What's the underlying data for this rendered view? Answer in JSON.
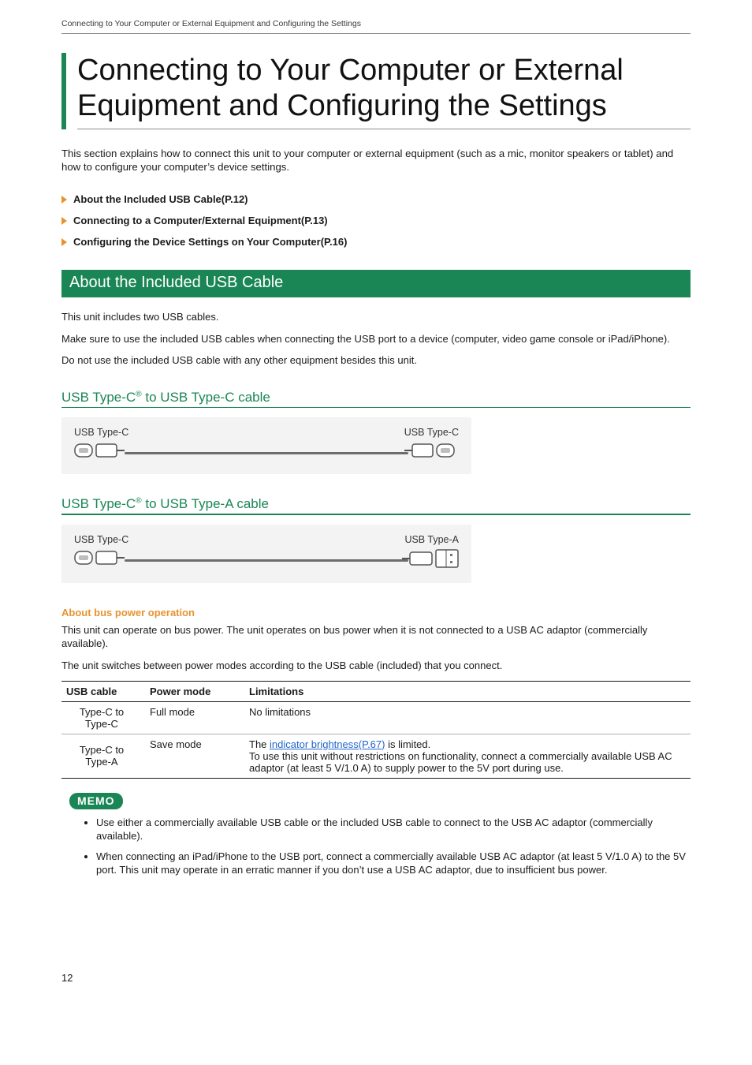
{
  "running_head": "Connecting to Your Computer or External Equipment and Configuring the Settings",
  "h1": "Connecting to Your Computer or External Equipment and Configuring the Settings",
  "intro": "This section explains how to connect this unit to your computer or external equipment (such as a mic, monitor speakers or tablet) and how to configure your computer’s device settings.",
  "toc": [
    "About the Included USB Cable(P.12)",
    "Connecting to a Computer/External Equipment(P.13)",
    "Configuring the Device Settings on Your Computer(P.16)"
  ],
  "green_heading": "About the Included USB Cable",
  "about_p1": "This unit includes two USB cables.",
  "about_p2": "Make sure to use the included USB cables when connecting the USB port to a device (computer, video game console or iPad/iPhone).",
  "about_p3": "Do not use the included USB cable with any other equipment besides this unit.",
  "cable1": {
    "title_pre": "USB Type-C",
    "title_post": " to USB Type-C cable",
    "left_label": "USB Type-C",
    "right_label": "USB Type-C"
  },
  "cable2": {
    "title_pre": "USB Type-C",
    "title_post": " to USB Type-A cable",
    "left_label": "USB Type-C",
    "right_label": "USB Type-A"
  },
  "bus": {
    "heading": "About bus power operation",
    "p1": "This unit can operate on bus power. The unit operates on bus power when it is not connected to a USB AC adaptor (commercially available).",
    "p2": "The unit switches between power modes according to the USB cable (included) that you connect."
  },
  "table": {
    "head": {
      "c1": "USB cable",
      "c2": "Power mode",
      "c3": "Limitations"
    },
    "row1": {
      "c1": "Type-C to Type-C",
      "c2": "Full mode",
      "c3": "No limitations"
    },
    "row2": {
      "c1": "Type-C to Type-A",
      "c2": "Save mode",
      "c3_pre": "The ",
      "c3_link": "indicator brightness(P.67)",
      "c3_post": " is limited.",
      "c3_line2": "To use this unit without restrictions on functionality, connect a commercially available USB AC adaptor (at least 5 V/1.0 A) to supply power to the 5V port during use."
    }
  },
  "memo": {
    "label": "MEMO",
    "items": [
      "Use either a commercially available USB cable or the included USB cable to connect to the USB AC adaptor (commercially available).",
      "When connecting an iPad/iPhone to the USB port, connect a commercially available USB AC adaptor (at least 5 V/1.0 A) to the 5V port. This unit may operate in an erratic manner if you don’t use a USB AC adaptor, due to insufficient bus power."
    ]
  },
  "page_number": "12"
}
